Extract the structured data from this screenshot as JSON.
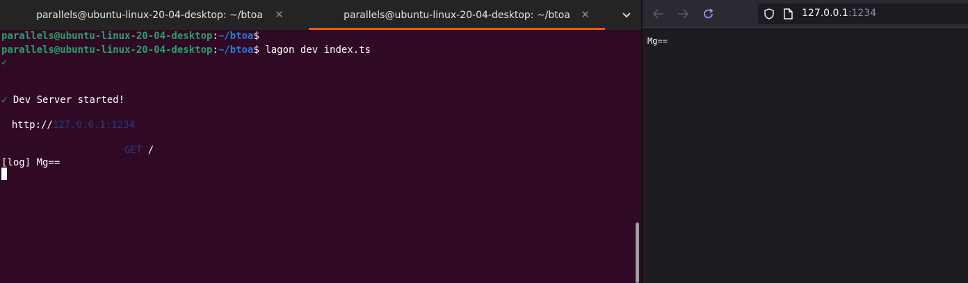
{
  "terminal": {
    "tabs": [
      {
        "title": "parallels@ubuntu-linux-20-04-desktop: ~/btoa",
        "active": false
      },
      {
        "title": "parallels@ubuntu-linux-20-04-desktop: ~/btoa",
        "active": true
      }
    ],
    "lines": {
      "prompt1_user": "parallels@ubuntu-linux-20-04-desktop",
      "prompt1_path": "~/btoa",
      "prompt2_user": "parallels@ubuntu-linux-20-04-desktop",
      "prompt2_path": "~/btoa",
      "command": " lagon dev index.ts",
      "check1": "✓",
      "dev_server": "Dev Server started!",
      "http_prefix": "http://",
      "http_host": "127.0.0.1:1234",
      "request_method": "GET",
      "request_path": " /",
      "log": "[log] Mg=="
    }
  },
  "browser": {
    "url_host": "127.0.0.1",
    "url_port": ":1234",
    "page_text": "Mg=="
  },
  "colors": {
    "terminal_bg": "#300a24",
    "prompt_green": "#26a269",
    "prompt_blue": "#2a7bde",
    "tab_accent": "#e95420",
    "browser_bg": "#1c1b22"
  }
}
